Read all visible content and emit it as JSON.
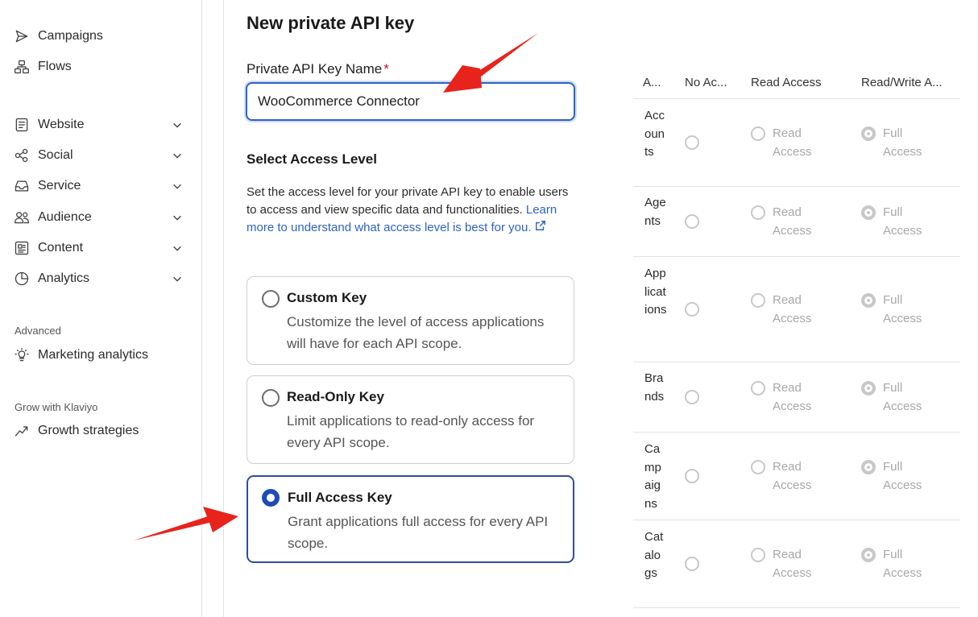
{
  "sidebar": {
    "items": [
      {
        "label": "Campaigns",
        "icon": "paper-plane-icon"
      },
      {
        "label": "Flows",
        "icon": "flow-tree-icon"
      },
      {
        "label": "Website",
        "icon": "document-icon"
      },
      {
        "label": "Social",
        "icon": "share-icon"
      },
      {
        "label": "Service",
        "icon": "inbox-icon"
      },
      {
        "label": "Audience",
        "icon": "users-icon"
      },
      {
        "label": "Content",
        "icon": "content-icon"
      },
      {
        "label": "Analytics",
        "icon": "pie-chart-icon"
      }
    ],
    "advanced_label": "Advanced",
    "advanced_item": {
      "label": "Marketing analytics",
      "icon": "lightbulb-icon"
    },
    "grow_label": "Grow with Klaviyo",
    "grow_item": {
      "label": "Growth strategies",
      "icon": "trend-up-icon"
    }
  },
  "form": {
    "title": "New private API key",
    "name_label": "Private API Key Name",
    "required_mark": "*",
    "name_value": "WooCommerce Connector",
    "access_title": "Select Access Level",
    "access_desc": "Set the access level for your private API key to enable users to access and view specific data and functionalities.",
    "learn_more": "Learn more to understand what access level is best for you.",
    "options": [
      {
        "title": "Custom Key",
        "desc": "Customize the level of access applications will have for each API scope.",
        "selected": false
      },
      {
        "title": "Read-Only Key",
        "desc": "Limit applications to read-only access for every API scope.",
        "selected": false
      },
      {
        "title": "Full Access Key",
        "desc": "Grant applications full access for every API scope.",
        "selected": true
      }
    ]
  },
  "permissions": {
    "headers": [
      "A...",
      "No Ac...",
      "Read Access",
      "Read/Write A..."
    ],
    "read_text": "Read Access",
    "full_text": "Full Access",
    "rows": [
      {
        "scope": "Accounts",
        "selected": "full"
      },
      {
        "scope": "Agents",
        "selected": "full"
      },
      {
        "scope": "Applications",
        "selected": "full"
      },
      {
        "scope": "Brands",
        "selected": "full"
      },
      {
        "scope": "Campaigns",
        "selected": "full"
      },
      {
        "scope": "Catalogs",
        "selected": "full"
      }
    ]
  },
  "colors": {
    "accent": "#2e63c5",
    "selected_radio": "#1e4bb5",
    "annotation_arrow": "#e8231b"
  }
}
